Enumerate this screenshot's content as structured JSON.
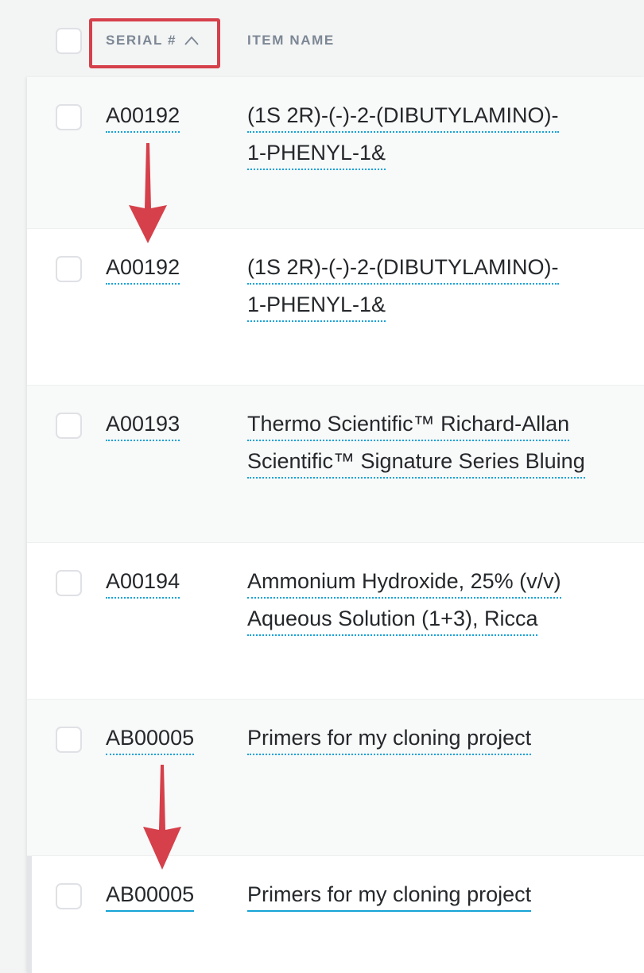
{
  "header": {
    "select_all_checked": false,
    "columns": [
      {
        "key": "serial",
        "label": "SERIAL #",
        "sort": "ascending",
        "sort_icon": "chevron-up-icon"
      },
      {
        "key": "item_name",
        "label": "ITEM NAME"
      }
    ]
  },
  "rows": [
    {
      "serial": "A00192",
      "name_lines": [
        "(1S 2R)-(-)-2-(DIBUTYLAMINO)-",
        "1-PHENYL-1&"
      ],
      "checked": false
    },
    {
      "serial": "A00192",
      "name_lines": [
        "(1S 2R)-(-)-2-(DIBUTYLAMINO)-",
        "1-PHENYL-1&"
      ],
      "checked": false
    },
    {
      "serial": "A00193",
      "name_lines": [
        "Thermo Scientific™ Richard-Allan",
        "Scientific™ Signature Series Bluing"
      ],
      "checked": false
    },
    {
      "serial": "A00194",
      "name_lines": [
        "Ammonium Hydroxide, 25% (v/v)",
        "Aqueous Solution (1+3), Ricca"
      ],
      "checked": false
    },
    {
      "serial": "AB00005",
      "name_lines": [
        "Primers for my cloning project"
      ],
      "checked": false
    },
    {
      "serial": "AB00005",
      "name_lines": [
        "Primers for my cloning project"
      ],
      "checked": false,
      "hovered": true
    }
  ],
  "annotations": {
    "highlight_color": "#d5404a",
    "arrow_color": "#d5404a",
    "link_color": "#16a3d6"
  }
}
